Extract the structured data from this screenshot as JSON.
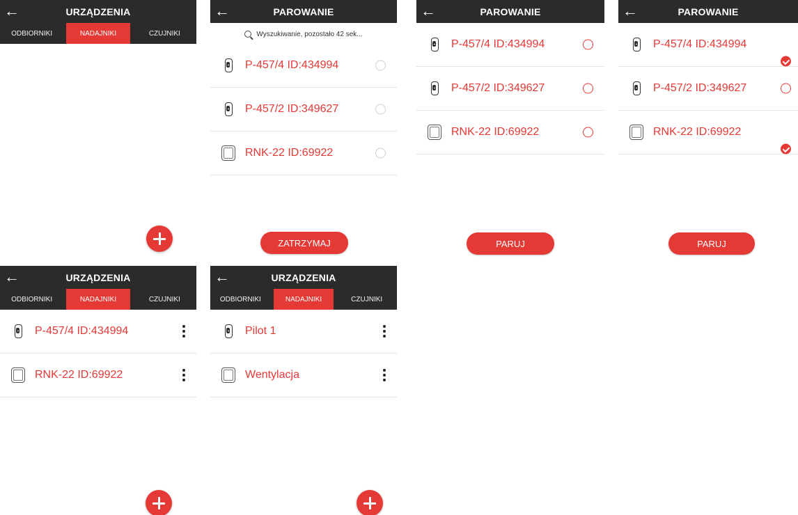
{
  "colors": {
    "accent": "#e53935",
    "bar": "#2b2b2b",
    "divider": "#e3e3e3"
  },
  "icons": {
    "back": "arrow-left-icon",
    "search": "search-icon",
    "remote": "remote-control-icon",
    "box": "box-device-icon",
    "add": "plus-icon",
    "more": "more-vertical-icon"
  },
  "back_arrow": "←",
  "devices": {
    "title": "URZĄDZENIA",
    "tabs": [
      "ODBIORNIKI",
      "NADAJNIKI",
      "CZUJNIKI"
    ]
  },
  "pairing": {
    "title": "PAROWANIE",
    "search_text": "Wyszukiwanie, pozostało 42 sek...",
    "stop_label": "ZATRZYMAJ",
    "pair_label": "PARUJ",
    "items": [
      "P-457/4 ID:434994",
      "P-457/2 ID:349627",
      "RNK-22 ID:69922"
    ]
  },
  "paired_list": {
    "items": [
      "P-457/4 ID:434994",
      "RNK-22 ID:69922"
    ]
  },
  "renamed_list": {
    "items": [
      "Pilot 1",
      "Wentylacja"
    ]
  }
}
